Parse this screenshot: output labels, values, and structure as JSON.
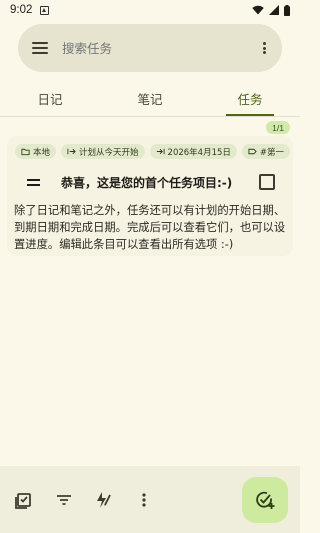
{
  "status_bar": {
    "time": "9:02",
    "icons": [
      "notification-icon",
      "wifi-icon",
      "signal-icon",
      "battery-icon"
    ]
  },
  "search": {
    "placeholder": "搜索任务",
    "icons": [
      "menu-icon",
      "more-vert-icon"
    ]
  },
  "tabs": [
    {
      "label": "日记",
      "active": false
    },
    {
      "label": "笔记",
      "active": false
    },
    {
      "label": "任务",
      "active": true
    }
  ],
  "page_indicator": "1/1",
  "task": {
    "chips": [
      {
        "icon": "folder-icon",
        "label": "本地"
      },
      {
        "icon": "start-icon",
        "label": "计划从今天开始"
      },
      {
        "icon": "due-icon",
        "label": "2026年4月15日"
      },
      {
        "icon": "tag-icon",
        "label": "#第一"
      }
    ],
    "title": "恭喜，这是您的首个任务项目:-)",
    "completed": false,
    "description": "除了日记和笔记之外，任务还可以有计划的开始日期、到期日期和完成日期。完成后可以查看它们，也可以设置进度。编辑此条目可以查看出所有选项 :-)"
  },
  "bottom_bar": {
    "icons": [
      "checklist-icon",
      "filter-icon",
      "quick-add-icon",
      "more-vert-icon"
    ],
    "fab_icon": "add-task-icon"
  },
  "colors": {
    "background": "#fbf8ea",
    "accent": "#4d6619",
    "chip": "#e2eacb",
    "fab": "#cdea9f"
  }
}
